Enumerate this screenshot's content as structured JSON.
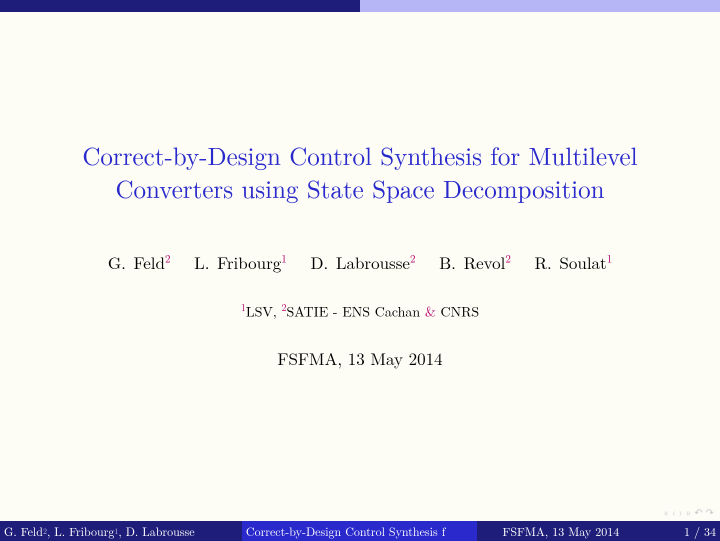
{
  "title_line1": "Correct-by-Design Control Synthesis for Multilevel",
  "title_line2": "Converters using State Space Decomposition",
  "authors": [
    {
      "name": "G. Feld",
      "aff": "2"
    },
    {
      "name": "L. Fribourg",
      "aff": "1"
    },
    {
      "name": "D. Labrousse",
      "aff": "2"
    },
    {
      "name": "B. Revol",
      "aff": "2"
    },
    {
      "name": "R. Soulat",
      "aff": "1"
    }
  ],
  "affil": {
    "sup1": "1",
    "part1": "LSV, ",
    "sup2": "2",
    "part2": "SATIE - ENS Cachan ",
    "amp": "&",
    "part3": " CNRS"
  },
  "date": "FSFMA, 13 May 2014",
  "footer": {
    "authors_a": "G. Feld",
    "authors_a_sup": "2",
    "authors_b": ", L. Fribourg",
    "authors_b_sup": "1",
    "authors_c": ", D. Labrousse",
    "title": "Correct-by-Design Control Synthesis f",
    "date": "FSFMA, 13 May 2014",
    "page": "1 / 34"
  },
  "nav": {
    "first": "«",
    "prev": "‹",
    "next": "›",
    "last": "»",
    "back": "↶",
    "fwd": "↷"
  }
}
